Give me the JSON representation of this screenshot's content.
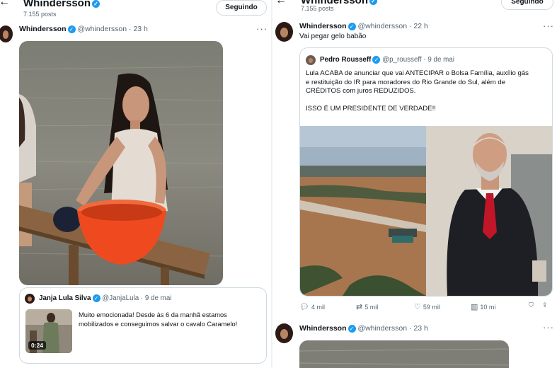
{
  "left": {
    "header": {
      "back_icon": "arrow-left-icon",
      "title": "Whindersson",
      "post_count": "7.155 posts",
      "follow_label": "Seguindo"
    },
    "tweet": {
      "name": "Whindersson",
      "handle": "@whindersson",
      "sep": "·",
      "time": "23 h",
      "more": "···"
    },
    "quote": {
      "name": "Janja Lula Silva",
      "handle": "@JanjaLula",
      "sep": "·",
      "date": "9 de mai",
      "text": "Muito emocionada! Desde às 6 da manhã estamos mobilizados e conseguimos salvar o cavalo Caramelo!",
      "video_duration": "0:24"
    }
  },
  "right": {
    "header": {
      "back_icon": "arrow-left-icon",
      "title": "Whindersson",
      "post_count": "7.155 posts",
      "follow_label": "Seguindo"
    },
    "tweet1": {
      "name": "Whindersson",
      "handle": "@whindersson",
      "sep": "·",
      "time": "22 h",
      "more": "···",
      "text": "Vai pegar gelo babão"
    },
    "quote": {
      "name": "Pedro Rousseff",
      "handle": "@p_rousseff",
      "sep": "·",
      "date": "9 de mai",
      "line1": "Lula ACABA de anunciar que vai ANTECIPAR o Bolsa Família, auxílio gás",
      "line2": "e restituição do IR para moradores do Rio Grande do Sul, além de",
      "line3": "CRÉDITOS com juros REDUZIDOS.",
      "line4": "ISSO É UM PRESIDENTE DE VERDADE!!"
    },
    "actions": {
      "replies": "4 mil",
      "reposts": "5 mil",
      "likes": "59 mil",
      "views": "10 mi"
    },
    "tweet2": {
      "name": "Whindersson",
      "handle": "@whindersson",
      "sep": "·",
      "time": "23 h",
      "more": "···"
    }
  },
  "colors": {
    "verified": "#1d9bf0",
    "text": "#0f1419",
    "meta": "#536471",
    "border": "#cfd9de",
    "basin": "#ef4a1f"
  }
}
